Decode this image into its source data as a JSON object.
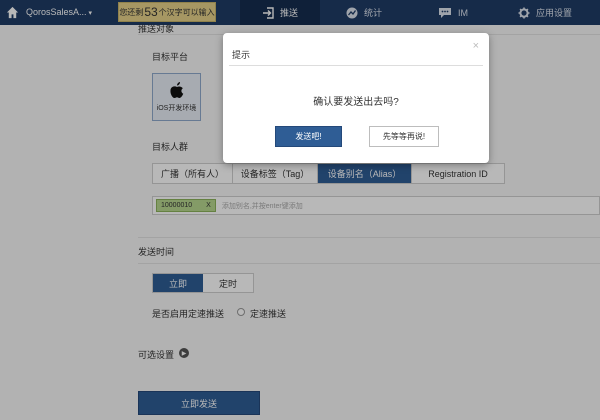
{
  "nav": {
    "app_name": "QorosSalesA...",
    "hint_prefix": "您还剩",
    "hint_count": "53",
    "hint_suffix": "个汉字可以输入",
    "items": [
      {
        "label": "推送",
        "icon": "send-icon",
        "active": true
      },
      {
        "label": "统计",
        "icon": "stats-icon",
        "active": false
      },
      {
        "label": "IM",
        "icon": "chat-icon",
        "active": false
      },
      {
        "label": "应用设置",
        "icon": "gear-icon",
        "active": false
      }
    ]
  },
  "form": {
    "section_cut": "推送对象",
    "target_platform_label": "目标平台",
    "platform_ios_label": "iOS开发环境",
    "audience_label": "目标人群",
    "audience_tabs": [
      {
        "label": "广播（所有人）",
        "active": false
      },
      {
        "label": "设备标签（Tag）",
        "active": false
      },
      {
        "label": "设备别名（Alias）",
        "active": true
      },
      {
        "label": "Registration ID",
        "active": false
      }
    ],
    "alias_tag_value": "10000010",
    "alias_tag_remove": "X",
    "alias_placeholder": "添加别名,并按enter键添加",
    "send_time_label": "发送时间",
    "send_time_options": [
      {
        "label": "立即",
        "active": true
      },
      {
        "label": "定时",
        "active": false
      }
    ],
    "rate_limit_question": "是否启用定速推送",
    "rate_limit_option": "定速推送",
    "optional_settings_label": "可选设置",
    "send_now_button": "立即发送"
  },
  "modal": {
    "title": "提示",
    "close": "×",
    "message": "确认要发送出去吗?",
    "confirm_button": "发送吧!",
    "cancel_button": "先等等再说!"
  },
  "colors": {
    "nav_bg": "#1f3c66",
    "primary": "#2f5d95",
    "tag_bg": "#b7d78f",
    "hint_bg": "#e6d28a"
  }
}
